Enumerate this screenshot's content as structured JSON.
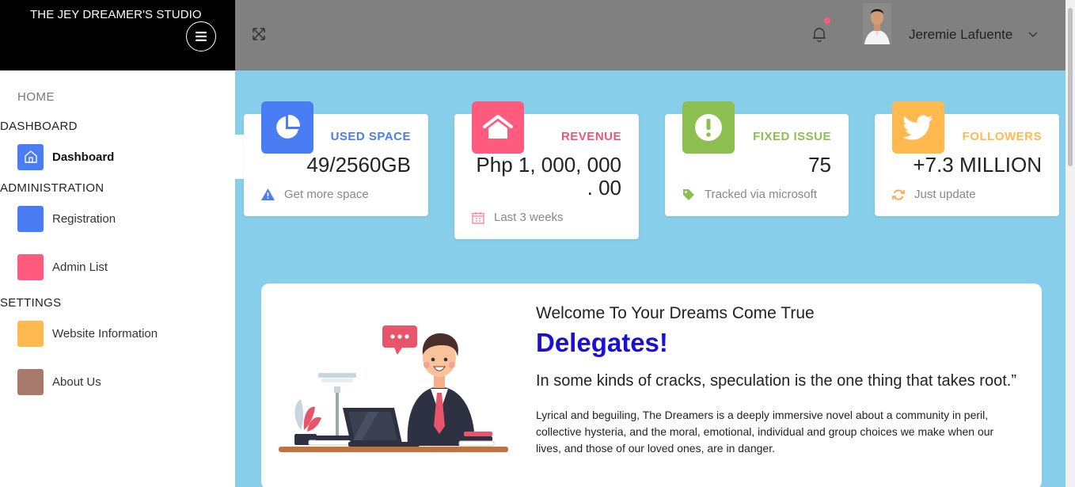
{
  "brand": {
    "title": "THE JEY DREAMER'S STUDIO"
  },
  "sidebar": {
    "home": "HOME",
    "sections": [
      {
        "label": "DASHBOARD"
      },
      {
        "label": "ADMINISTRATION"
      },
      {
        "label": "SETTINGS"
      }
    ],
    "items": [
      {
        "label": "Dashboard",
        "icon": "home-icon",
        "color": "#4a7cf3",
        "active": true
      },
      {
        "label": "Registration",
        "icon": "blank-tile",
        "color": "#4a7cf3"
      },
      {
        "label": "Admin List",
        "icon": "blank-tile",
        "color": "#ff5b7e"
      },
      {
        "label": "Website Information",
        "icon": "blank-tile",
        "color": "#ffb94f"
      },
      {
        "label": "About Us",
        "icon": "blank-tile",
        "color": "#a87a6c"
      }
    ]
  },
  "topbar": {
    "user_name": "Jeremie Lafuente",
    "notification_dot_color": "#ff5b7e"
  },
  "cards": [
    {
      "title": "USED SPACE",
      "value": "49/2560GB",
      "footer": "Get more space",
      "color": "#4a7cf3",
      "icon": "pie-chart-icon",
      "footer_icon": "warning-icon"
    },
    {
      "title": "REVENUE",
      "value_line1": "Php 1, 000, 000",
      "value_line2": ". 00",
      "footer": "Last 3 weeks",
      "color": "#ff5b7e",
      "icon": "house-icon",
      "footer_icon": "calendar-icon"
    },
    {
      "title": "FIXED ISSUE",
      "value": "75",
      "footer": "Tracked via microsoft",
      "color": "#8cbf4f",
      "icon": "exclamation-icon",
      "footer_icon": "tag-icon"
    },
    {
      "title": "FOLLOWERS",
      "value": "+7.3 MILLION",
      "footer": "Just update",
      "color": "#ffb94f",
      "icon": "twitter-icon",
      "footer_icon": "refresh-icon"
    }
  ],
  "welcome": {
    "heading": "Welcome To Your Dreams Come True",
    "title": "Delegates!",
    "quote": "In some kinds of cracks, speculation is the one thing that takes root.”",
    "body": "Lyrical and beguiling, The Dreamers is a deeply immersive novel about a community in peril, collective hysteria, and the moral, emotional, individual and group choices we make when our lives, and those of our loved ones, are in danger."
  }
}
